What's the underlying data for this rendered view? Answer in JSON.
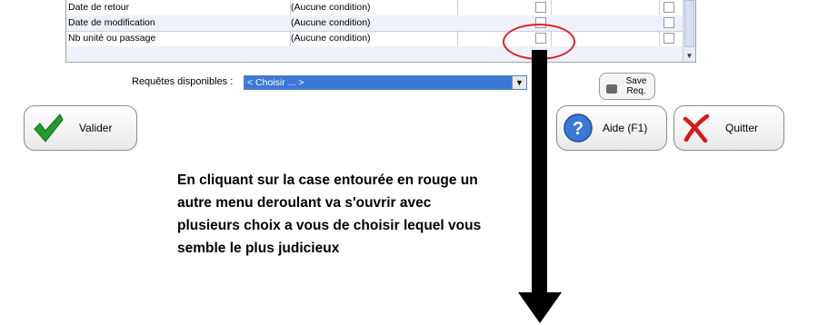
{
  "grid": {
    "rows": [
      {
        "field": "Date de retour",
        "condition": "(Aucune condition)"
      },
      {
        "field": "Date de modification",
        "condition": "(Aucune condition)"
      },
      {
        "field": "Nb unité ou passage",
        "condition": "(Aucune condition)"
      },
      {
        "field": "",
        "condition": ""
      }
    ]
  },
  "requests": {
    "label": "Requêtes disponibles :",
    "selected": "< Choisir ... >"
  },
  "buttons": {
    "save": "Save Req.",
    "valider": "Valider",
    "aide": "Aide (F1)",
    "quitter": "Quitter"
  },
  "icons": {
    "valider": "green-check-icon",
    "aide": "blue-help-icon",
    "quitter": "red-x-icon",
    "save": "disk-icon"
  },
  "annotation": {
    "lines": [
      "En cliquant sur la case entourée en rouge un",
      "autre menu deroulant va s'ouvrir avec",
      "plusieurs choix a vous de choisir lequel vous",
      "semble le plus judicieux"
    ],
    "circle_color": "#e02020",
    "arrow_color": "#000000"
  }
}
